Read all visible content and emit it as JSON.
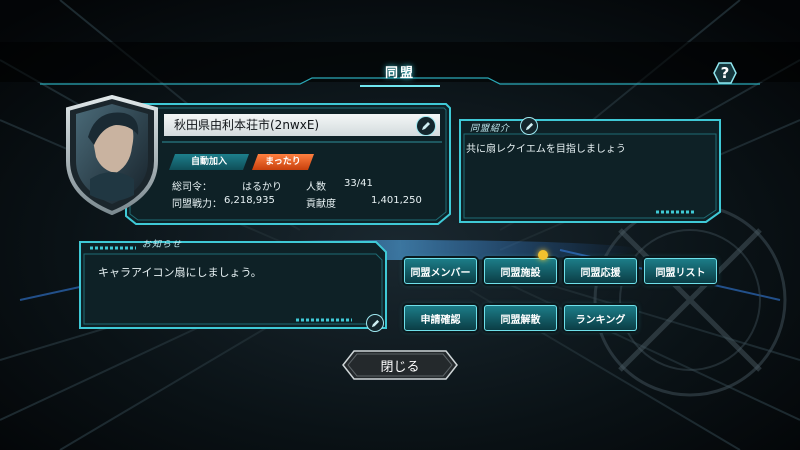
{
  "header": {
    "title": "同盟",
    "help_glyph": "?"
  },
  "alliance": {
    "name": "秋田県由利本荘市(2nwxE)",
    "tags": [
      "自動加入",
      "まったり"
    ],
    "commander_label": "総司令：",
    "commander_value": "はるかり",
    "members_label": "人数",
    "members_value": "33/41",
    "power_label": "同盟戦力：",
    "power_value": "6,218,935",
    "contribution_label": "貢献度",
    "contribution_value": "1,401,250"
  },
  "intro": {
    "label": "同盟紹介",
    "text": "共に扇レクイエムを目指しましょう"
  },
  "news": {
    "label": "お知らせ",
    "text": "キャラアイコン扇にしましょう。"
  },
  "buttons": [
    "同盟メンバー",
    "同盟施設",
    "同盟応援",
    "同盟リスト",
    "申請確認",
    "同盟解散",
    "ランキング"
  ],
  "close_label": "閉じる",
  "colors": {
    "accent": "#3fc9d6",
    "panel": "#0f2a30",
    "tag_orange": "#e8611f",
    "notify": "#f2c12e"
  },
  "icons": [
    "help-icon",
    "edit-icon",
    "notification-dot-icon",
    "alliance-emblem-icon"
  ]
}
